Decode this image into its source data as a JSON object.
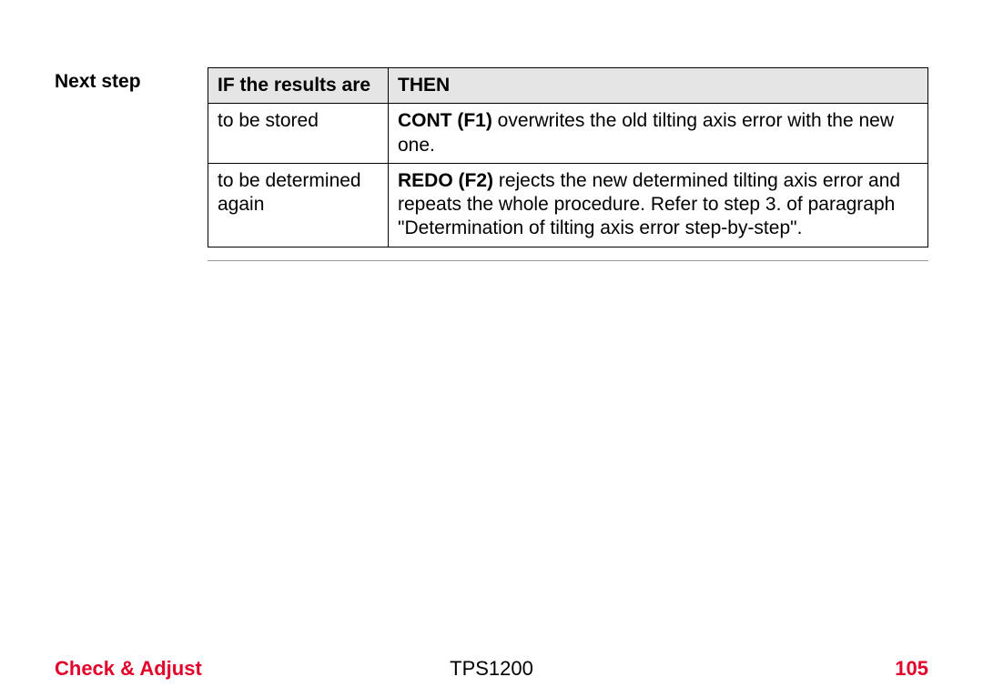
{
  "sideLabel": "Next step",
  "table": {
    "headers": {
      "if": "IF the results are",
      "then": "THEN"
    },
    "rows": [
      {
        "if": "to be stored",
        "then_bold": "CONT (F1)",
        "then_rest": " overwrites the old tilting axis error with the new one."
      },
      {
        "if": "to be determined again",
        "then_bold": "REDO (F2)",
        "then_rest": " rejects the new determined tilting axis error and repeats the whole procedure. Refer to step 3. of paragraph \"Determination of tilting axis error step-by-step\"."
      }
    ]
  },
  "footer": {
    "left": "Check & Adjust",
    "center": "TPS1200",
    "right": "105"
  }
}
